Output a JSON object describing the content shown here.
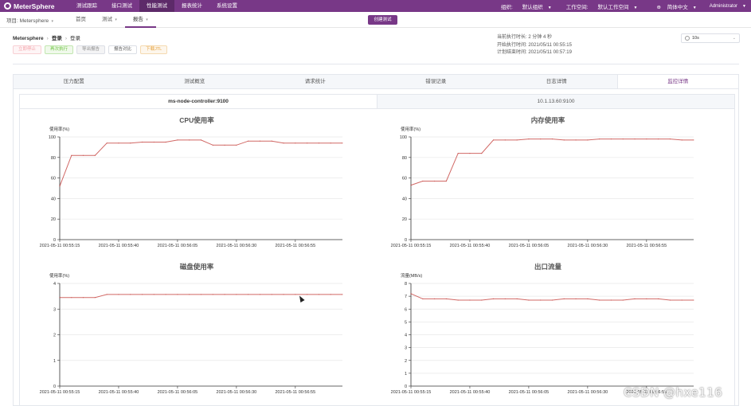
{
  "nav": {
    "brand": "MeterSphere",
    "items": [
      "测试跟踪",
      "接口测试",
      "性能测试",
      "报表统计",
      "系统设置"
    ],
    "active_index": 2,
    "org_label": "组织:",
    "org_value": "默认组织",
    "workspace_label": "工作空间:",
    "workspace_value": "默认工作空间",
    "language": "简体中文",
    "user": "Administrator"
  },
  "subnav": {
    "project": "项目: Metersphere",
    "items": [
      "首页",
      "测试",
      "报告"
    ],
    "active_index": 2,
    "create_button": "创建测试"
  },
  "breadcrumb": [
    "Metersphere",
    "登录",
    "登录"
  ],
  "actions": {
    "stop": "立即停止",
    "rerun": "再次执行",
    "export": "导出报告",
    "compare": "报告对比",
    "download": "下载JTL"
  },
  "run_info": {
    "duration_label": "当前执行时长:",
    "duration_value": "2 分钟 4 秒",
    "start_label": "开始执行时间:",
    "start_value": "2021/05/11 00:55:15",
    "end_label": "计划结束时间:",
    "end_value": "2021/05/11 00:57:19"
  },
  "refresh_select": {
    "value": "10s"
  },
  "tabs": [
    "压力配置",
    "测试概览",
    "请求统计",
    "错误记录",
    "日志详情",
    "监控详情"
  ],
  "active_tab": 5,
  "monitor_tabs": [
    "ms-node-controller:9100",
    "10.1.13.60:9100"
  ],
  "active_monitor_tab": 0,
  "watermark": "CSDN @hxe116",
  "chart_data": [
    {
      "type": "line",
      "title": "CPU使用率",
      "ylabel": "使用率(%)",
      "ylim": [
        0,
        100
      ],
      "yticks": [
        0,
        20,
        40,
        60,
        80,
        100
      ],
      "xticks": [
        "2021-05-11 00:55:15",
        "2021-05-11 00:55:40",
        "2021-05-11 00:56:05",
        "2021-05-11 00:56:30",
        "2021-05-11 00:56:55"
      ],
      "series": [
        {
          "color": "#c23531",
          "values": [
            52,
            82,
            82,
            82,
            94,
            94,
            94,
            95,
            95,
            95,
            97,
            97,
            97,
            92,
            92,
            92,
            96,
            96,
            96,
            94,
            94,
            94,
            94,
            94,
            94
          ]
        }
      ]
    },
    {
      "type": "line",
      "title": "内存使用率",
      "ylabel": "使用率(%)",
      "ylim": [
        0,
        100
      ],
      "yticks": [
        0,
        20,
        40,
        60,
        80,
        100
      ],
      "xticks": [
        "2021-05-11 00:55:15",
        "2021-05-11 00:55:40",
        "2021-05-11 00:56:05",
        "2021-05-11 00:56:30",
        "2021-05-11 00:56:55"
      ],
      "series": [
        {
          "color": "#c23531",
          "values": [
            53,
            57,
            57,
            57,
            84,
            84,
            84,
            97,
            97,
            97,
            98,
            98,
            98,
            97,
            97,
            97,
            98,
            98,
            98,
            98,
            98,
            98,
            98,
            97,
            97
          ]
        }
      ]
    },
    {
      "type": "line",
      "title": "磁盘使用率",
      "ylabel": "使用率(%)",
      "ylim": [
        0,
        4
      ],
      "yticks": [
        0,
        1,
        2,
        3,
        4
      ],
      "xticks": [
        "2021-05-11 00:55:15",
        "2021-05-11 00:55:40",
        "2021-05-11 00:56:05",
        "2021-05-11 00:56:30",
        "2021-05-11 00:56:55"
      ],
      "series": [
        {
          "color": "#c23531",
          "values": [
            3.45,
            3.45,
            3.45,
            3.45,
            3.57,
            3.57,
            3.57,
            3.57,
            3.57,
            3.57,
            3.57,
            3.57,
            3.57,
            3.57,
            3.57,
            3.57,
            3.57,
            3.57,
            3.57,
            3.57,
            3.57,
            3.57,
            3.57,
            3.57,
            3.57
          ]
        }
      ]
    },
    {
      "type": "line",
      "title": "出口流量",
      "ylabel": "流量(MB/s)",
      "ylim": [
        0,
        8
      ],
      "yticks": [
        0,
        1,
        2,
        3,
        4,
        5,
        6,
        7,
        8
      ],
      "xticks": [
        "2021-05-11 00:55:15",
        "2021-05-11 00:55:40",
        "2021-05-11 00:56:05",
        "2021-05-11 00:56:30",
        "2021-05-11 00:56:55"
      ],
      "series": [
        {
          "color": "#c23531",
          "values": [
            7.2,
            6.8,
            6.8,
            6.8,
            6.7,
            6.7,
            6.7,
            6.8,
            6.8,
            6.8,
            6.7,
            6.7,
            6.7,
            6.8,
            6.8,
            6.8,
            6.7,
            6.7,
            6.7,
            6.8,
            6.8,
            6.8,
            6.7,
            6.7,
            6.7
          ]
        }
      ]
    }
  ]
}
